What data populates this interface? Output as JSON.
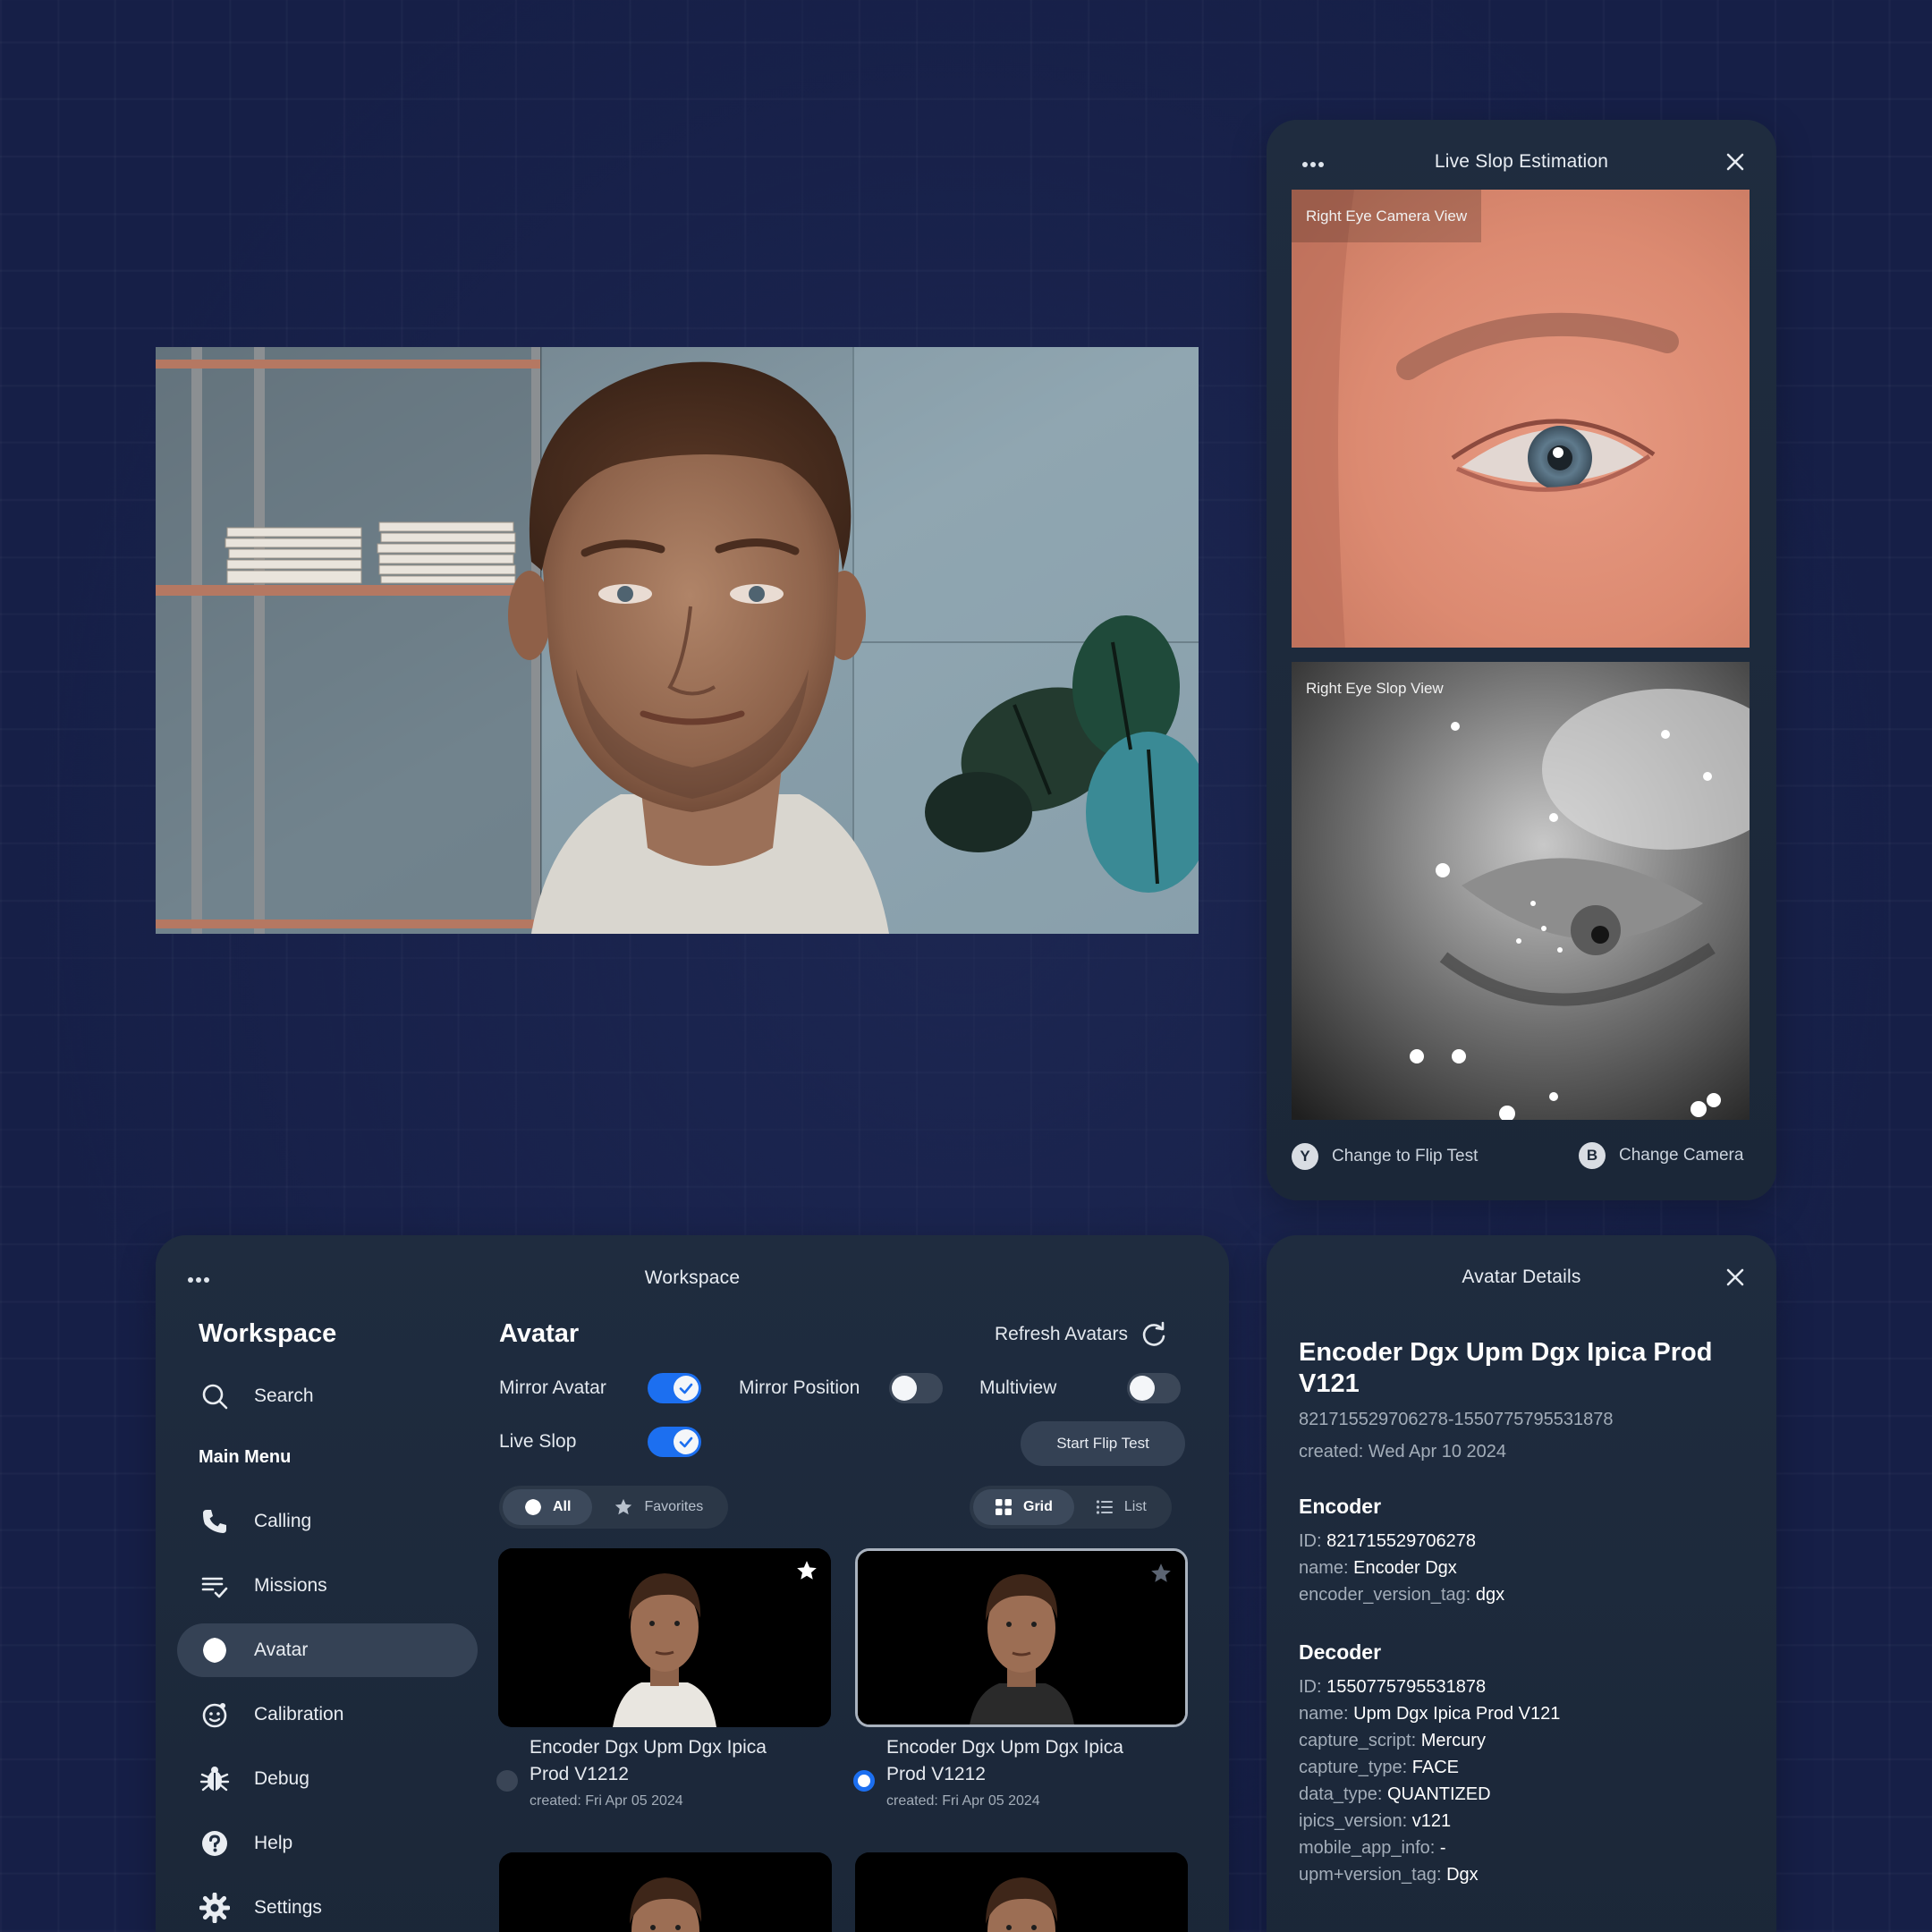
{
  "main_view": {
    "image": "3d-avatar-face-render"
  },
  "live_slop": {
    "title": "Live Slop Estimation",
    "camera_view_label": "Right Eye Camera View",
    "slop_view_label": "Right Eye Slop View",
    "flip_action": {
      "badge": "Y",
      "label": "Change to Flip Test"
    },
    "camera_action": {
      "badge": "B",
      "label": "Change Camera"
    }
  },
  "workspace": {
    "window_title": "Workspace",
    "sidebar": {
      "title": "Workspace",
      "search_label": "Search",
      "section_label": "Main Menu",
      "items": [
        {
          "label": "Calling",
          "icon": "phone-icon"
        },
        {
          "label": "Missions",
          "icon": "checklist-icon"
        },
        {
          "label": "Avatar",
          "icon": "avatar-blob-icon",
          "active": true
        },
        {
          "label": "Calibration",
          "icon": "calibration-face-icon"
        },
        {
          "label": "Debug",
          "icon": "bug-icon"
        },
        {
          "label": "Help",
          "icon": "help-icon"
        },
        {
          "label": "Settings",
          "icon": "gear-icon"
        }
      ]
    },
    "main": {
      "title": "Avatar",
      "refresh_label": "Refresh Avatars",
      "toggles": {
        "mirror_avatar": {
          "label": "Mirror Avatar",
          "on": true
        },
        "mirror_position": {
          "label": "Mirror Position",
          "on": false
        },
        "multiview": {
          "label": "Multiview",
          "on": false
        },
        "live_slop": {
          "label": "Live Slop",
          "on": true
        }
      },
      "start_flip_label": "Start Flip Test",
      "filter_tabs": [
        {
          "label": "All",
          "active": true
        },
        {
          "label": "Favorites",
          "active": false
        }
      ],
      "view_tabs": [
        {
          "label": "Grid",
          "active": true
        },
        {
          "label": "List",
          "active": false
        }
      ],
      "cards": [
        {
          "title": "Encoder Dgx Upm Dgx Ipica Prod V1212",
          "date": "created: Fri Apr 05 2024",
          "selected": false,
          "favorite": true
        },
        {
          "title": "Encoder Dgx Upm Dgx Ipica Prod V1212",
          "date": "created: Fri Apr 05 2024",
          "selected": true,
          "favorite": false
        }
      ]
    }
  },
  "details": {
    "title": "Avatar Details",
    "name": "Encoder Dgx Upm Dgx Ipica Prod V121",
    "id_pair": "821715529706278-1550775795531878",
    "created": "created: Wed Apr 10 2024",
    "encoder": {
      "heading": "Encoder",
      "fields": [
        {
          "key": "ID:",
          "value": "821715529706278"
        },
        {
          "key": "name:",
          "value": "Encoder Dgx"
        },
        {
          "key": "encoder_version_tag:",
          "value": "dgx"
        }
      ]
    },
    "decoder": {
      "heading": "Decoder",
      "fields": [
        {
          "key": "ID:",
          "value": "1550775795531878"
        },
        {
          "key": "name:",
          "value": "Upm Dgx Ipica Prod V121"
        },
        {
          "key": "capture_script:",
          "value": "Mercury"
        },
        {
          "key": "capture_type:",
          "value": "FACE"
        },
        {
          "key": "data_type:",
          "value": "QUANTIZED"
        },
        {
          "key": "ipics_version:",
          "value": "v121"
        },
        {
          "key": "mobile_app_info:",
          "value": "-"
        },
        {
          "key": "upm+version_tag:",
          "value": "Dgx"
        }
      ]
    }
  },
  "colors": {
    "accent": "#1c6ff0",
    "panel": "#1f2c3f",
    "background": "#161f47"
  }
}
